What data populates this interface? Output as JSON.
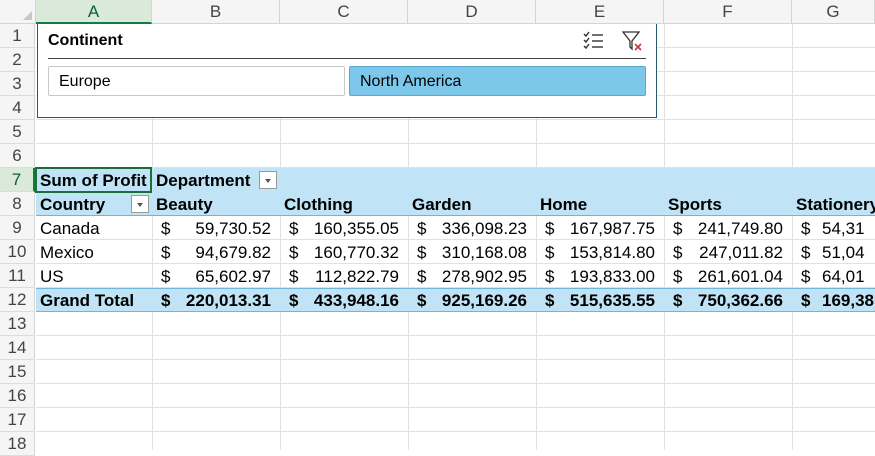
{
  "columns": [
    "A",
    "B",
    "C",
    "D",
    "E",
    "F",
    "G"
  ],
  "rows": [
    "1",
    "2",
    "3",
    "4",
    "5",
    "6",
    "7",
    "8",
    "9",
    "10",
    "11",
    "12",
    "13",
    "14",
    "15",
    "16",
    "17",
    "18"
  ],
  "slicer": {
    "title": "Continent",
    "items": [
      {
        "label": "Europe",
        "selected": false
      },
      {
        "label": "North America",
        "selected": true
      }
    ],
    "multiselect_icon": "multi-select-icon",
    "clear_filter_icon": "clear-filter-icon"
  },
  "pivot": {
    "value_field": "Sum of Profit",
    "column_field": "Department",
    "row_field": "Country",
    "departments": [
      "Beauty",
      "Clothing",
      "Garden",
      "Home",
      "Sports",
      "Stationery"
    ],
    "rows": [
      {
        "country": "Canada",
        "values": [
          "59,730.52",
          "160,355.05",
          "336,098.23",
          "167,987.75",
          "241,749.80",
          "54,31"
        ]
      },
      {
        "country": "Mexico",
        "values": [
          "94,679.82",
          "160,770.32",
          "310,168.08",
          "153,814.80",
          "247,011.82",
          "51,04"
        ]
      },
      {
        "country": "US",
        "values": [
          "65,602.97",
          "112,822.79",
          "278,902.95",
          "193,833.00",
          "261,601.04",
          "64,01"
        ]
      }
    ],
    "grand_total": {
      "label": "Grand Total",
      "values": [
        "220,013.31",
        "433,948.16",
        "925,169.26",
        "515,635.55",
        "750,362.66",
        "169,38"
      ]
    },
    "currency": "$"
  },
  "colors": {
    "band": "#c0e4f5",
    "slicer_selected": "#7dc8ea",
    "select_green": "#107c41"
  }
}
